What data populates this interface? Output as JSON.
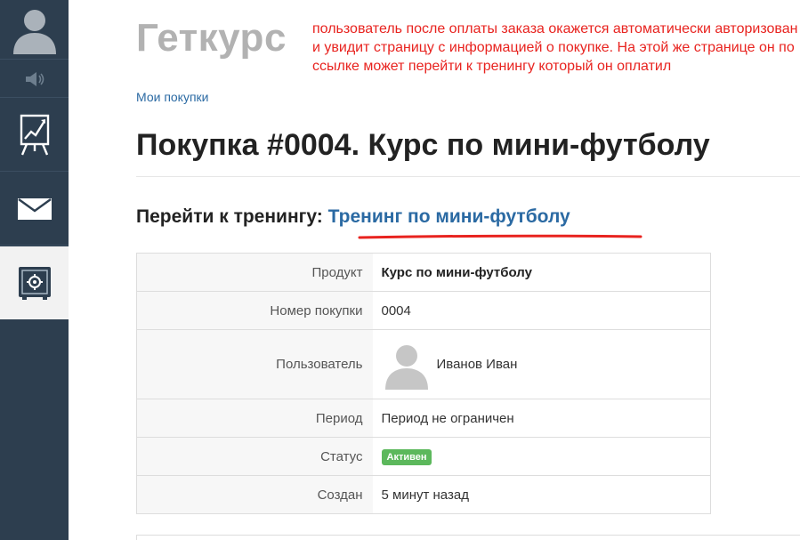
{
  "sidebar": {
    "items": [
      {
        "icon": "user-avatar-icon"
      },
      {
        "icon": "speaker-icon"
      },
      {
        "icon": "chart-board-icon"
      },
      {
        "icon": "envelope-icon"
      },
      {
        "icon": "safe-icon",
        "active": true
      }
    ],
    "bg_color": "#2d3e4f"
  },
  "header": {
    "logo": "Геткурс",
    "annotation": "пользователь после оплаты заказа окажется автоматически авторизован и увидит страницу с информацией о покупке. На этой же странице он по ссылке может перейти к тренингу который он оплатил"
  },
  "breadcrumb": "Мои покупки",
  "page_title": "Покупка #0004. Курс по мини-футболу",
  "goto": {
    "label": "Перейти к тренингу:",
    "link": "Тренинг по мини-футболу"
  },
  "details": {
    "product_label": "Продукт",
    "product_value": "Курс по мини-футболу",
    "number_label": "Номер покупки",
    "number_value": "0004",
    "user_label": "Пользователь",
    "user_value": "Иванов Иван",
    "period_label": "Период",
    "period_value": "Период не ограничен",
    "status_label": "Статус",
    "status_value": "Активен",
    "created_label": "Создан",
    "created_value": "5 минут назад"
  },
  "colors": {
    "link": "#2b6aa3",
    "annotation": "#e8231f",
    "badge": "#5cb85c"
  }
}
